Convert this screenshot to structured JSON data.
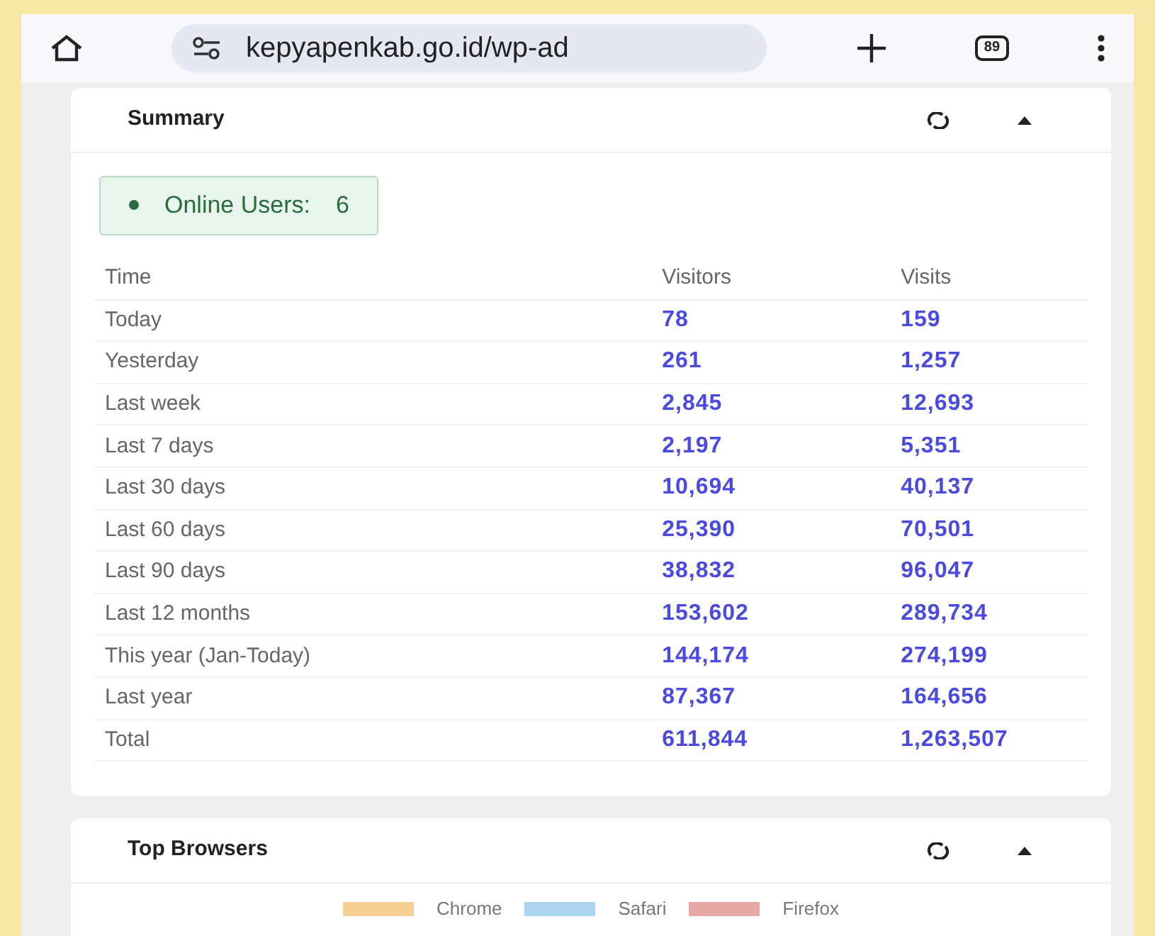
{
  "browser": {
    "url": "kepyapenkab.go.id/wp-ad",
    "tab_count": "89"
  },
  "summary": {
    "title": "Summary",
    "online": {
      "label": "Online Users:",
      "value": "6"
    },
    "columns": [
      "Time",
      "Visitors",
      "Visits"
    ],
    "rows": [
      {
        "time": "Today",
        "visitors": "78",
        "visits": "159"
      },
      {
        "time": "Yesterday",
        "visitors": "261",
        "visits": "1,257"
      },
      {
        "time": "Last week",
        "visitors": "2,845",
        "visits": "12,693"
      },
      {
        "time": "Last 7 days",
        "visitors": "2,197",
        "visits": "5,351"
      },
      {
        "time": "Last 30 days",
        "visitors": "10,694",
        "visits": "40,137"
      },
      {
        "time": "Last 60 days",
        "visitors": "25,390",
        "visits": "70,501"
      },
      {
        "time": "Last 90 days",
        "visitors": "38,832",
        "visits": "96,047"
      },
      {
        "time": "Last 12 months",
        "visitors": "153,602",
        "visits": "289,734"
      },
      {
        "time": "This year (Jan-Today)",
        "visitors": "144,174",
        "visits": "274,199"
      },
      {
        "time": "Last year",
        "visitors": "87,367",
        "visits": "164,656"
      },
      {
        "time": "Total",
        "visitors": "611,844",
        "visits": "1,263,507"
      }
    ]
  },
  "top_browsers": {
    "title": "Top Browsers",
    "legend": [
      {
        "name": "Chrome",
        "color": "#f5cf95"
      },
      {
        "name": "Safari",
        "color": "#acd4ee"
      },
      {
        "name": "Firefox",
        "color": "#e8a8a5"
      }
    ]
  }
}
